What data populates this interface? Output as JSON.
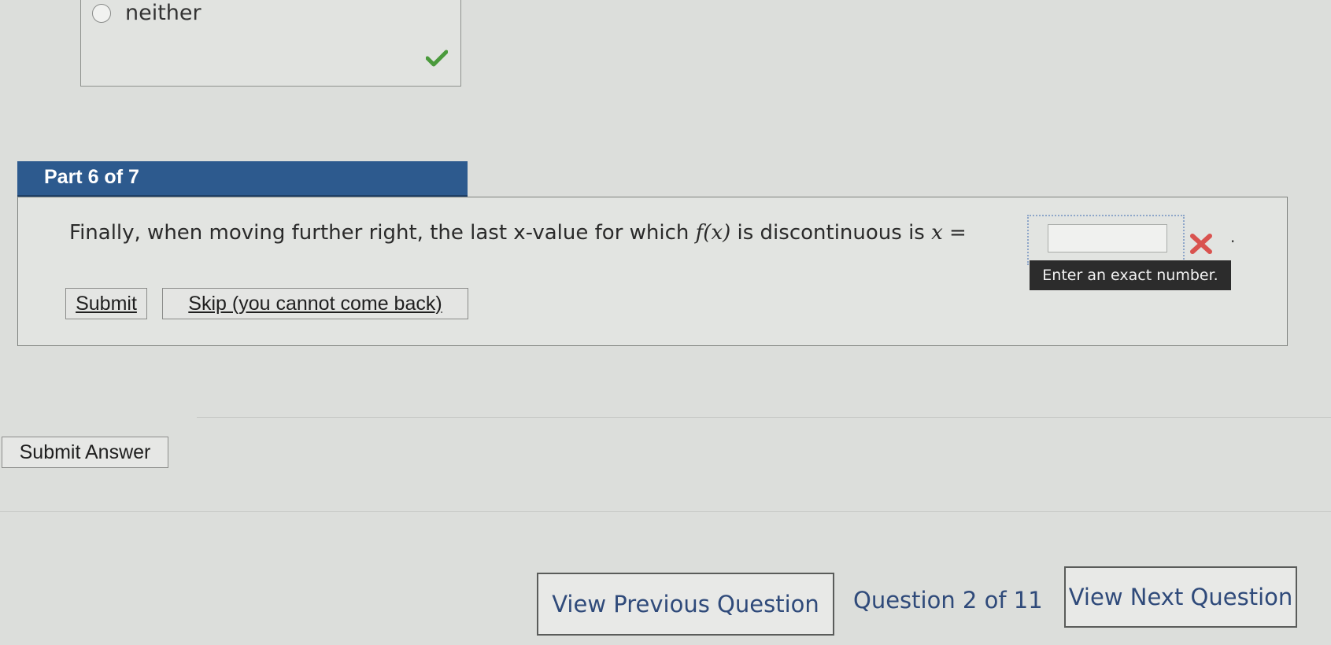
{
  "previous_part": {
    "option_label": "neither",
    "status_icon": "checkmark-icon",
    "status_color": "#4a9a3c"
  },
  "part": {
    "title": "Part 6 of 7",
    "header_color": "#2d5a8e",
    "question_prefix": "Finally, when moving further right, the last x-value for which ",
    "function_label": "f(x)",
    "question_suffix": " is discontinuous is ",
    "variable": "x",
    "equals": "=",
    "answer_value": "",
    "answer_status_icon": "wrong-x-icon",
    "answer_status_color": "#d9534f",
    "trailing": ".",
    "hint": "Enter an exact number.",
    "submit_label": "Submit",
    "skip_label": "Skip (you cannot come back)"
  },
  "submit_answer_label": "Submit Answer",
  "navigation": {
    "previous_label": "View Previous Question",
    "counter": "Question 2 of 11",
    "next_label": "View Next Question"
  }
}
